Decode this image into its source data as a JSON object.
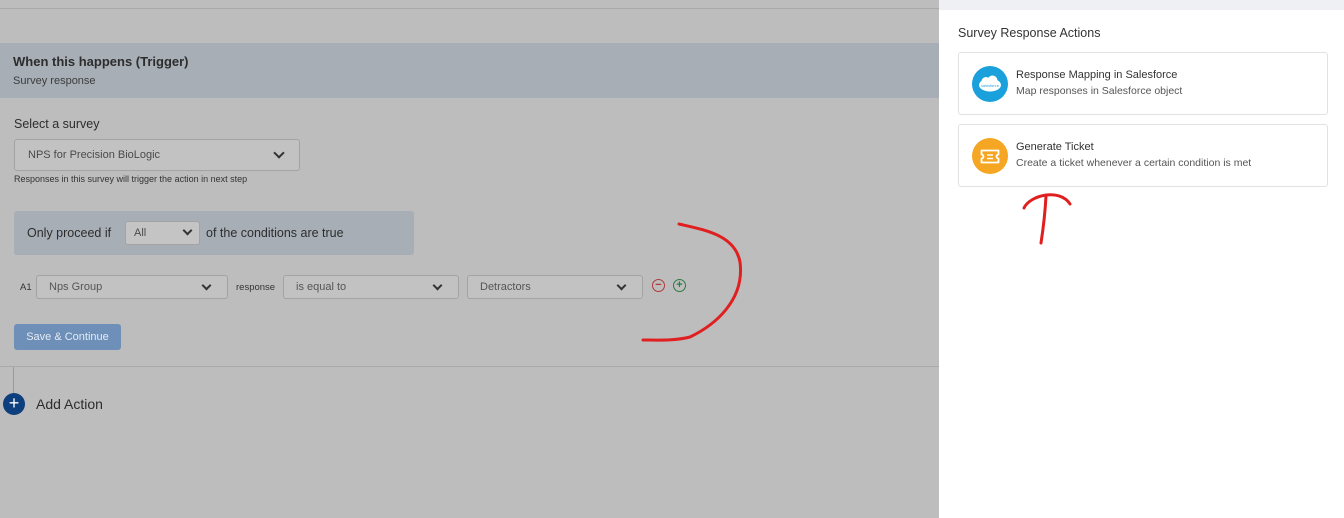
{
  "trigger": {
    "title": "When this happens (Trigger)",
    "subtitle": "Survey response"
  },
  "survey": {
    "label": "Select a survey",
    "selected": "NPS for Precision BioLogic",
    "help": "Responses in this survey will trigger the action in next step"
  },
  "conditions": {
    "prefix": "Only proceed if",
    "mode": "All",
    "suffix": "of the conditions are true"
  },
  "rule": {
    "id": "A1",
    "field": "Nps Group",
    "connector": "response",
    "operator": "is equal to",
    "value": "Detractors"
  },
  "actions": {
    "save_label": "Save & Continue",
    "add_label": "Add Action",
    "remove_symbol": "−",
    "add_symbol": "+"
  },
  "panel": {
    "title": "Survey Response Actions",
    "cards": [
      {
        "title": "Response Mapping in Salesforce",
        "desc": "Map responses in Salesforce object",
        "icon": "salesforce-icon",
        "icon_label": "salesforce",
        "color": "#1aa0db"
      },
      {
        "title": "Generate Ticket",
        "desc": "Create a ticket whenever a certain condition is met",
        "icon": "ticket-icon",
        "color": "#f5a623"
      }
    ]
  },
  "colors": {
    "overlay": "#bdbdbd",
    "header_band": "#a7aeb6",
    "save_button": "#6e8fb8",
    "add_action": "#0d3e7d",
    "annotation": "#e02020"
  }
}
